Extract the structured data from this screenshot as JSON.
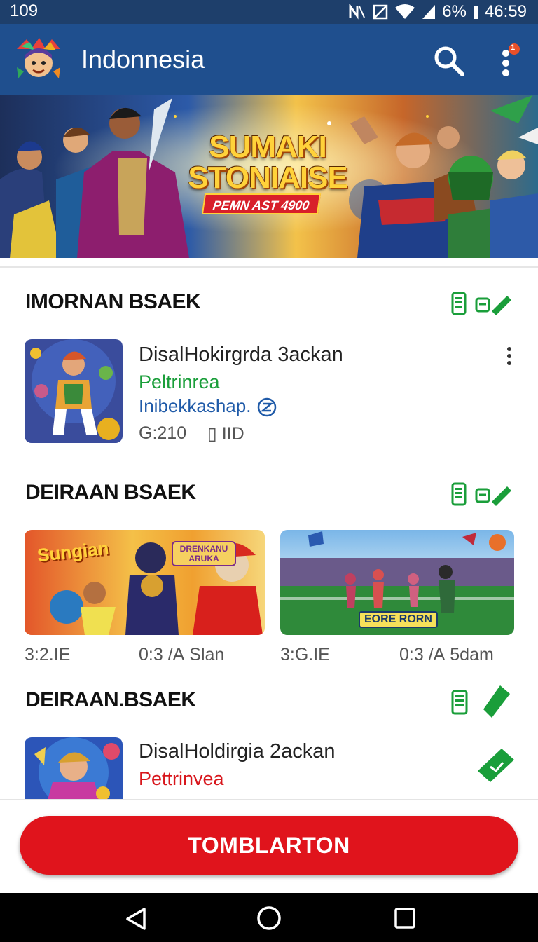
{
  "status_bar": {
    "time_left": "109",
    "battery": "6%",
    "clock": "46:59"
  },
  "app_bar": {
    "title": "Indonnesia",
    "logo_icon": "app-logo-icon",
    "search_icon": "search-icon",
    "menu_icon": "more-vert-icon",
    "notification_badge": "1"
  },
  "banner": {
    "title_line1": "SUMAKI",
    "title_line2": "STONIAISE",
    "subtitle": "PEMN AST 4900"
  },
  "sections": [
    {
      "title": "IMORNAN BSAEK",
      "items": [
        {
          "title": "DisalHokirgrda 3ackan",
          "subtitle": "Peltrinrea",
          "subtitle_color": "#1a9e3a",
          "tagline": "Inibekkashap.",
          "meta_left": "G:210",
          "meta_right": "▯ IID"
        }
      ]
    },
    {
      "title": "DEIRAAN BSAEK",
      "cards": [
        {
          "title_badge": "Sungian",
          "badge2": "DRENKANU ARUKA",
          "meta_left": "3:2.IE",
          "meta_right": "0:3 /А Slan"
        },
        {
          "title_badge": "EORE RORN",
          "meta_left": "3:G.IE",
          "meta_right": "0:3 /А 5dam"
        }
      ]
    },
    {
      "title": "DEIRAAN.BSAEK",
      "items": [
        {
          "title": "DisalHoldirgia 2ackan",
          "subtitle": "Pettrinvea",
          "subtitle_color": "#d8161c"
        }
      ]
    }
  ],
  "cta": {
    "label": "TOMBLARTON"
  },
  "colors": {
    "app_bar": "#1f4f8e",
    "status_bar": "#1e3f6b",
    "accent_green": "#1a9e3a",
    "cta_red": "#e0141c"
  }
}
